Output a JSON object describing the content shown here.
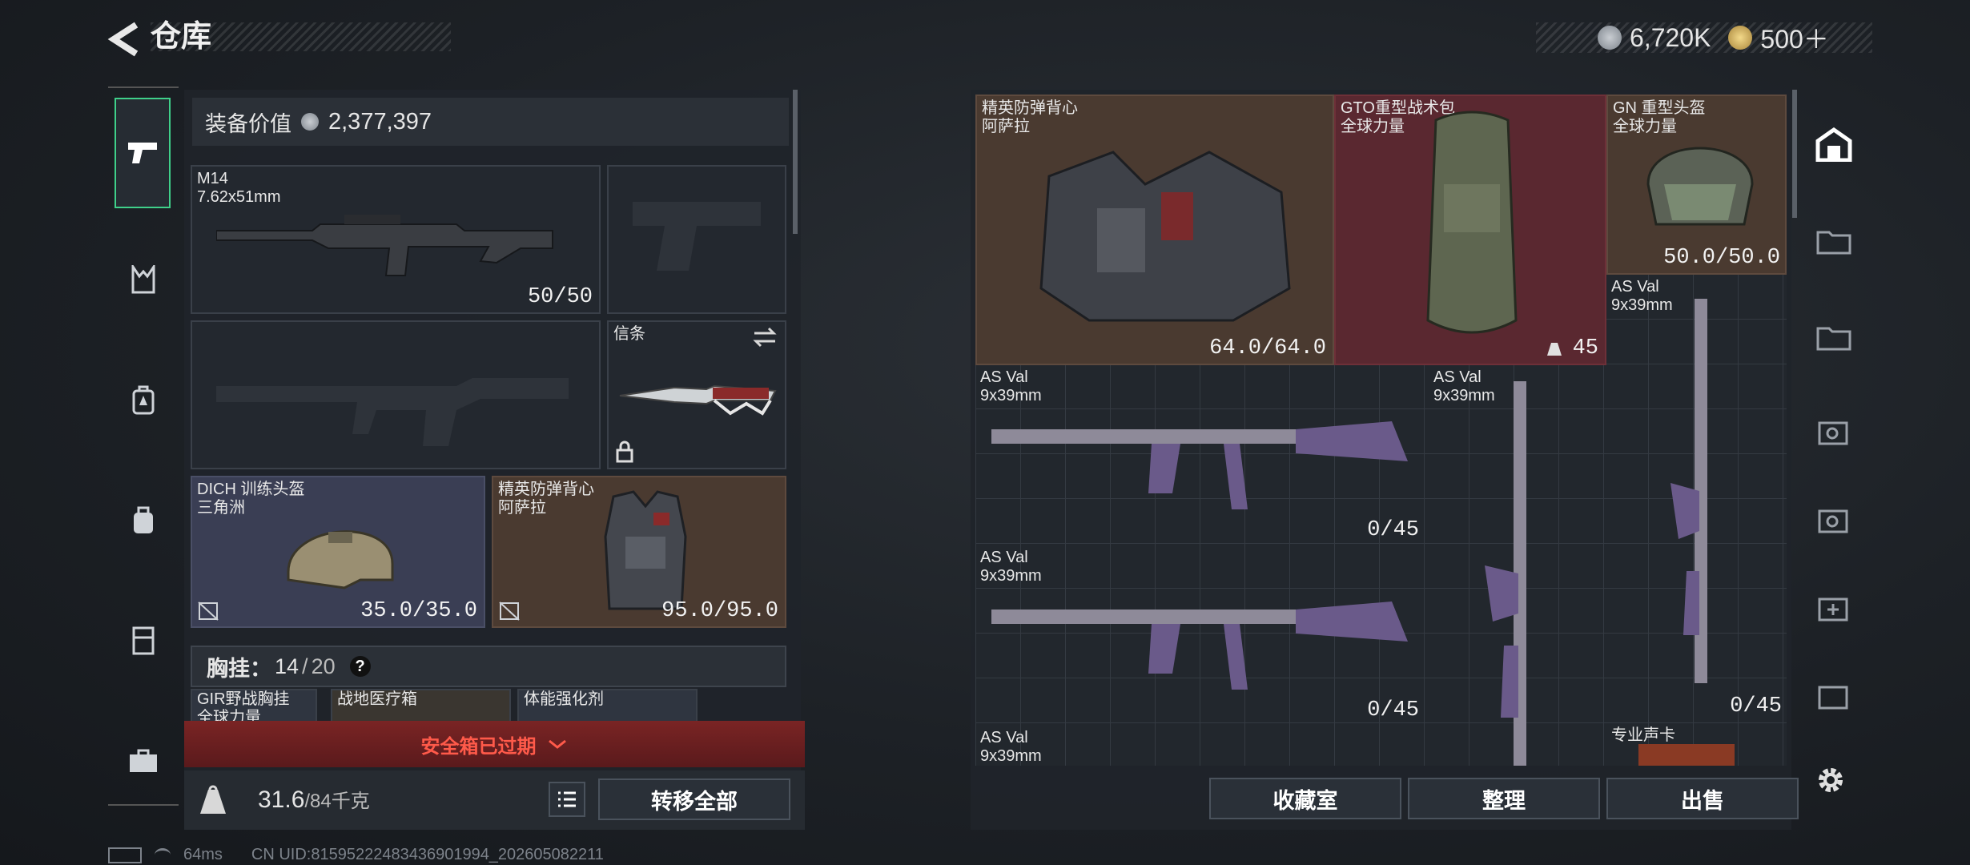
{
  "header": {
    "title": "仓库",
    "currency_amount": "6,720K",
    "premium_amount": "500＋"
  },
  "loadout": {
    "value_label": "装备价值",
    "value": "2,377,397",
    "primary": {
      "name": "M14",
      "caliber": "7.62x51mm",
      "ammo": "50/50"
    },
    "melee": {
      "name": "信条"
    },
    "helmet": {
      "name": "DICH 训练头盔",
      "brand": "三角洲",
      "durability": "35.0/35.0"
    },
    "armor": {
      "name": "精英防弹背心",
      "brand": "阿萨拉",
      "durability": "95.0/95.0"
    },
    "rig": {
      "label": "胸挂：",
      "count": "14",
      "capacity": "20",
      "help": "?"
    },
    "rig_items": [
      "GIR野战胸挂",
      "战地医疗箱",
      "体能强化剂"
    ],
    "rig_item_sub": "全球力量",
    "safebox": "安全箱已过期",
    "weight": {
      "current": "31.6",
      "max": "/84千克"
    },
    "transfer_all": "转移全部"
  },
  "storage": {
    "items": [
      {
        "name": "精英防弹背心",
        "brand": "阿萨拉",
        "value": "64.0/64.0"
      },
      {
        "name": "GTO重型战术包",
        "brand": "全球力量",
        "value": "45"
      },
      {
        "name": "GN 重型头盔",
        "brand": "全球力量",
        "value": "50.0/50.0"
      },
      {
        "name": "AS Val",
        "caliber": "9x39mm",
        "value": "0/45"
      },
      {
        "name": "AS Val",
        "caliber": "9x39mm",
        "value": "0/45"
      },
      {
        "name": "AS Val",
        "caliber": "9x39mm",
        "value": "0/45"
      },
      {
        "name": "AS Val",
        "caliber": "9x39mm",
        "value": "0/45"
      },
      {
        "name": "AS Val",
        "caliber": "9x39mm",
        "value": ""
      },
      {
        "name": "专业声卡",
        "value": ""
      }
    ],
    "buttons": {
      "collection": "收藏室",
      "organize": "整理",
      "sell": "出售"
    }
  },
  "status_bar": {
    "ping": "64ms",
    "uid": "CN UID:81595222483436901994_202605082211"
  },
  "colors": {
    "accent_green": "#3fd08a",
    "alert_red": "#ff5a4a",
    "armor_slot": "#4a3a30",
    "bag_slot": "#5a2830",
    "helmet_slot": "#3a3e54"
  },
  "icons": {
    "back": "back-arrow-icon",
    "coin": "coin-icon",
    "gold": "gold-coin-icon",
    "settings": "gear-icon"
  }
}
